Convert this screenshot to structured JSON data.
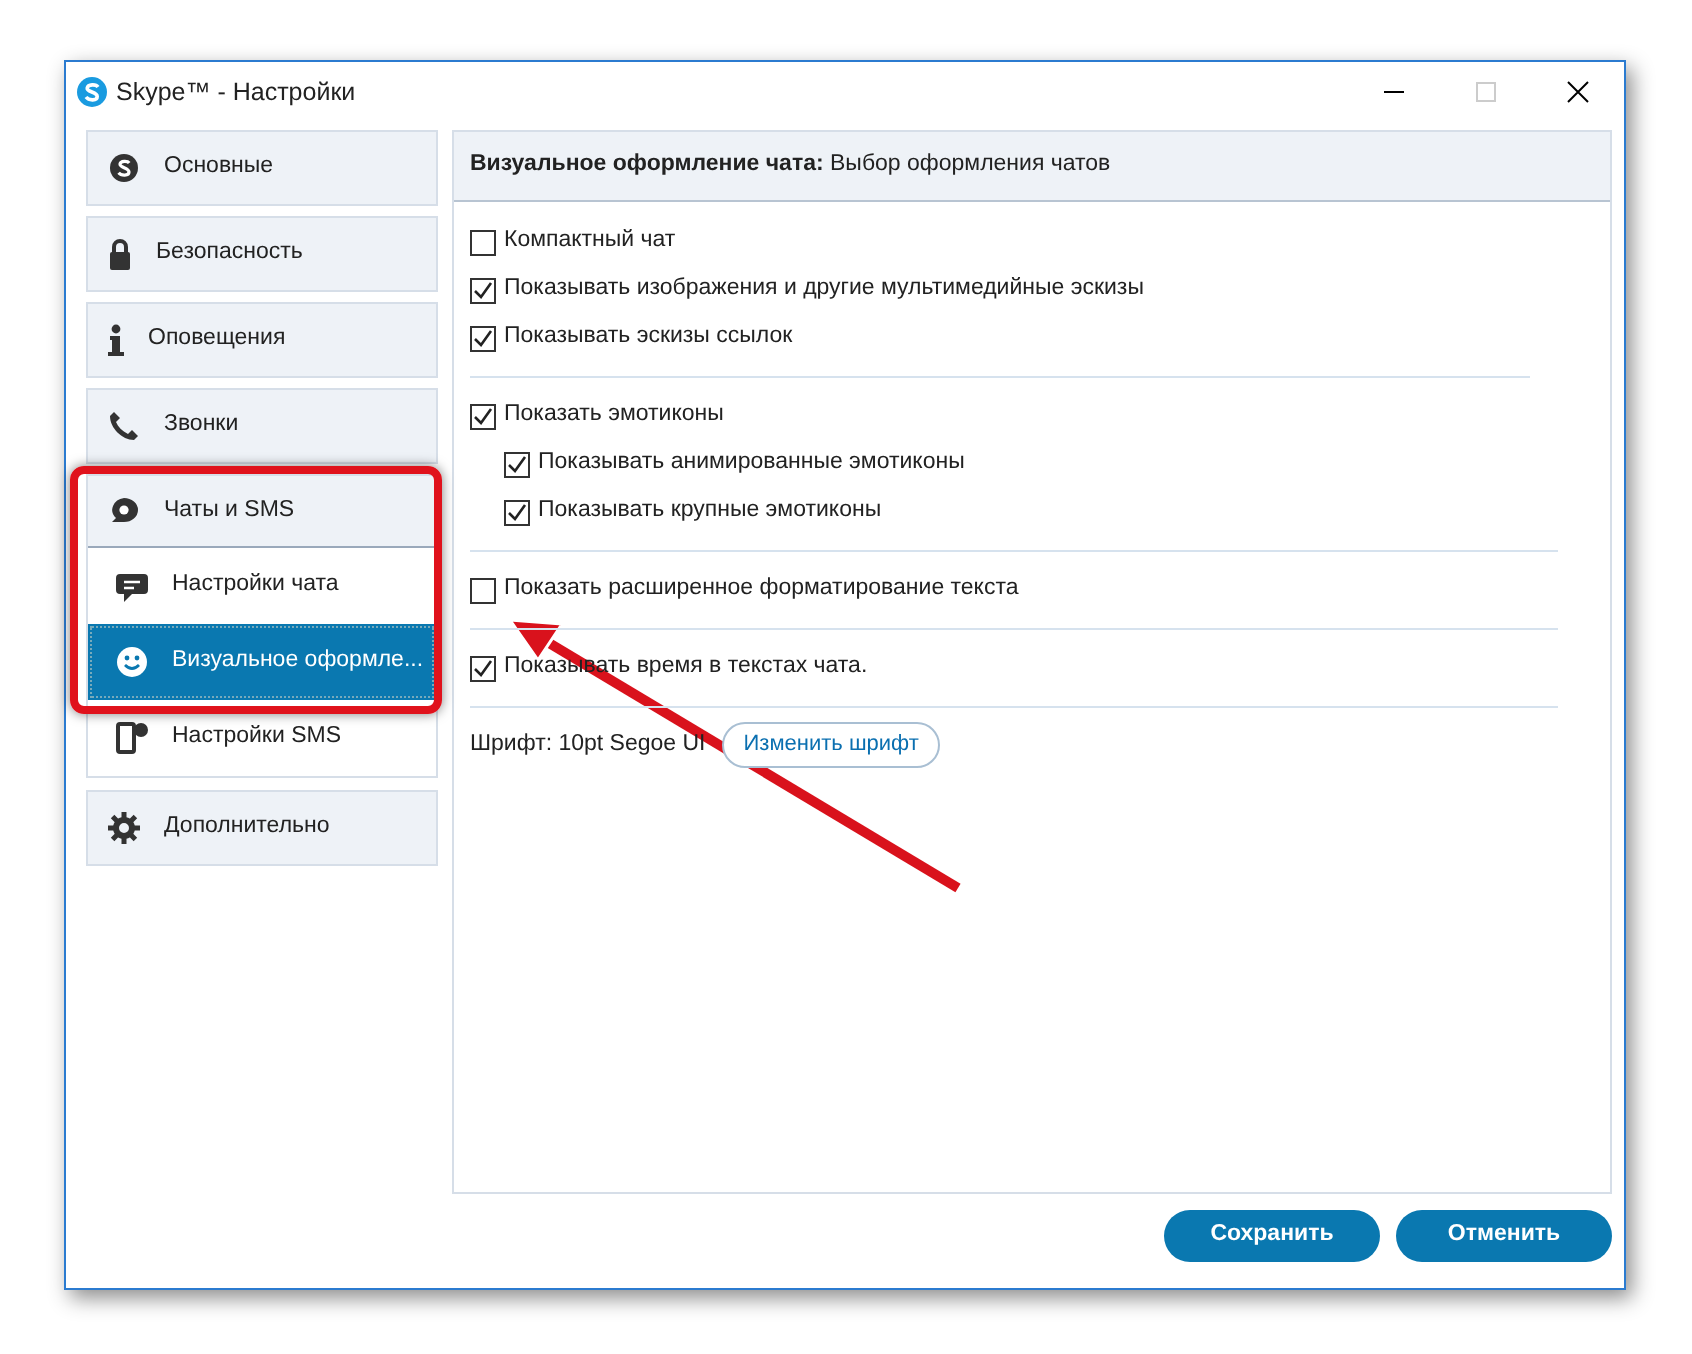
{
  "window": {
    "title": "Skype™ - Настройки"
  },
  "sidebar": {
    "items": [
      {
        "label": "Основные",
        "selected": false
      },
      {
        "label": "Безопасность",
        "selected": false
      },
      {
        "label": "Оповещения",
        "selected": false
      },
      {
        "label": "Звонки",
        "selected": false
      },
      {
        "label": "Чаты и SMS",
        "selected": false,
        "expanded": true,
        "children": [
          {
            "label": "Настройки чата",
            "selected": false
          },
          {
            "label": "Визуальное оформле...",
            "selected": true
          },
          {
            "label": "Настройки SMS",
            "selected": false
          }
        ]
      },
      {
        "label": "Дополнительно",
        "selected": false
      }
    ]
  },
  "panel": {
    "header": "**Визуальное оформление чата:** Выбор оформления чатов",
    "groups": [
      [
        {
          "label": "Компактный чат",
          "checked": false
        },
        {
          "label": "Показывать изображения и другие мультимедийные эскизы",
          "checked": true
        },
        {
          "label": "Показывать эскизы ссылок",
          "checked": true
        }
      ],
      [
        {
          "label": "Показать эмотиконы",
          "checked": true,
          "children": [
            {
              "label": "Показывать анимированные эмотиконы",
              "checked": true
            },
            {
              "label": "Показывать крупные эмотиконы",
              "checked": true
            }
          ]
        }
      ],
      [
        {
          "label": "Показать расширенное форматирование текста",
          "checked": false
        }
      ],
      [
        {
          "label": "Показывать время в текстах чата.",
          "checked": true
        }
      ]
    ],
    "font": {
      "label": "Шрифт: 10pt Segoe UI",
      "button": "Изменить шрифт"
    }
  },
  "buttons": [
    "Сохранить",
    "Отменить"
  ]
}
